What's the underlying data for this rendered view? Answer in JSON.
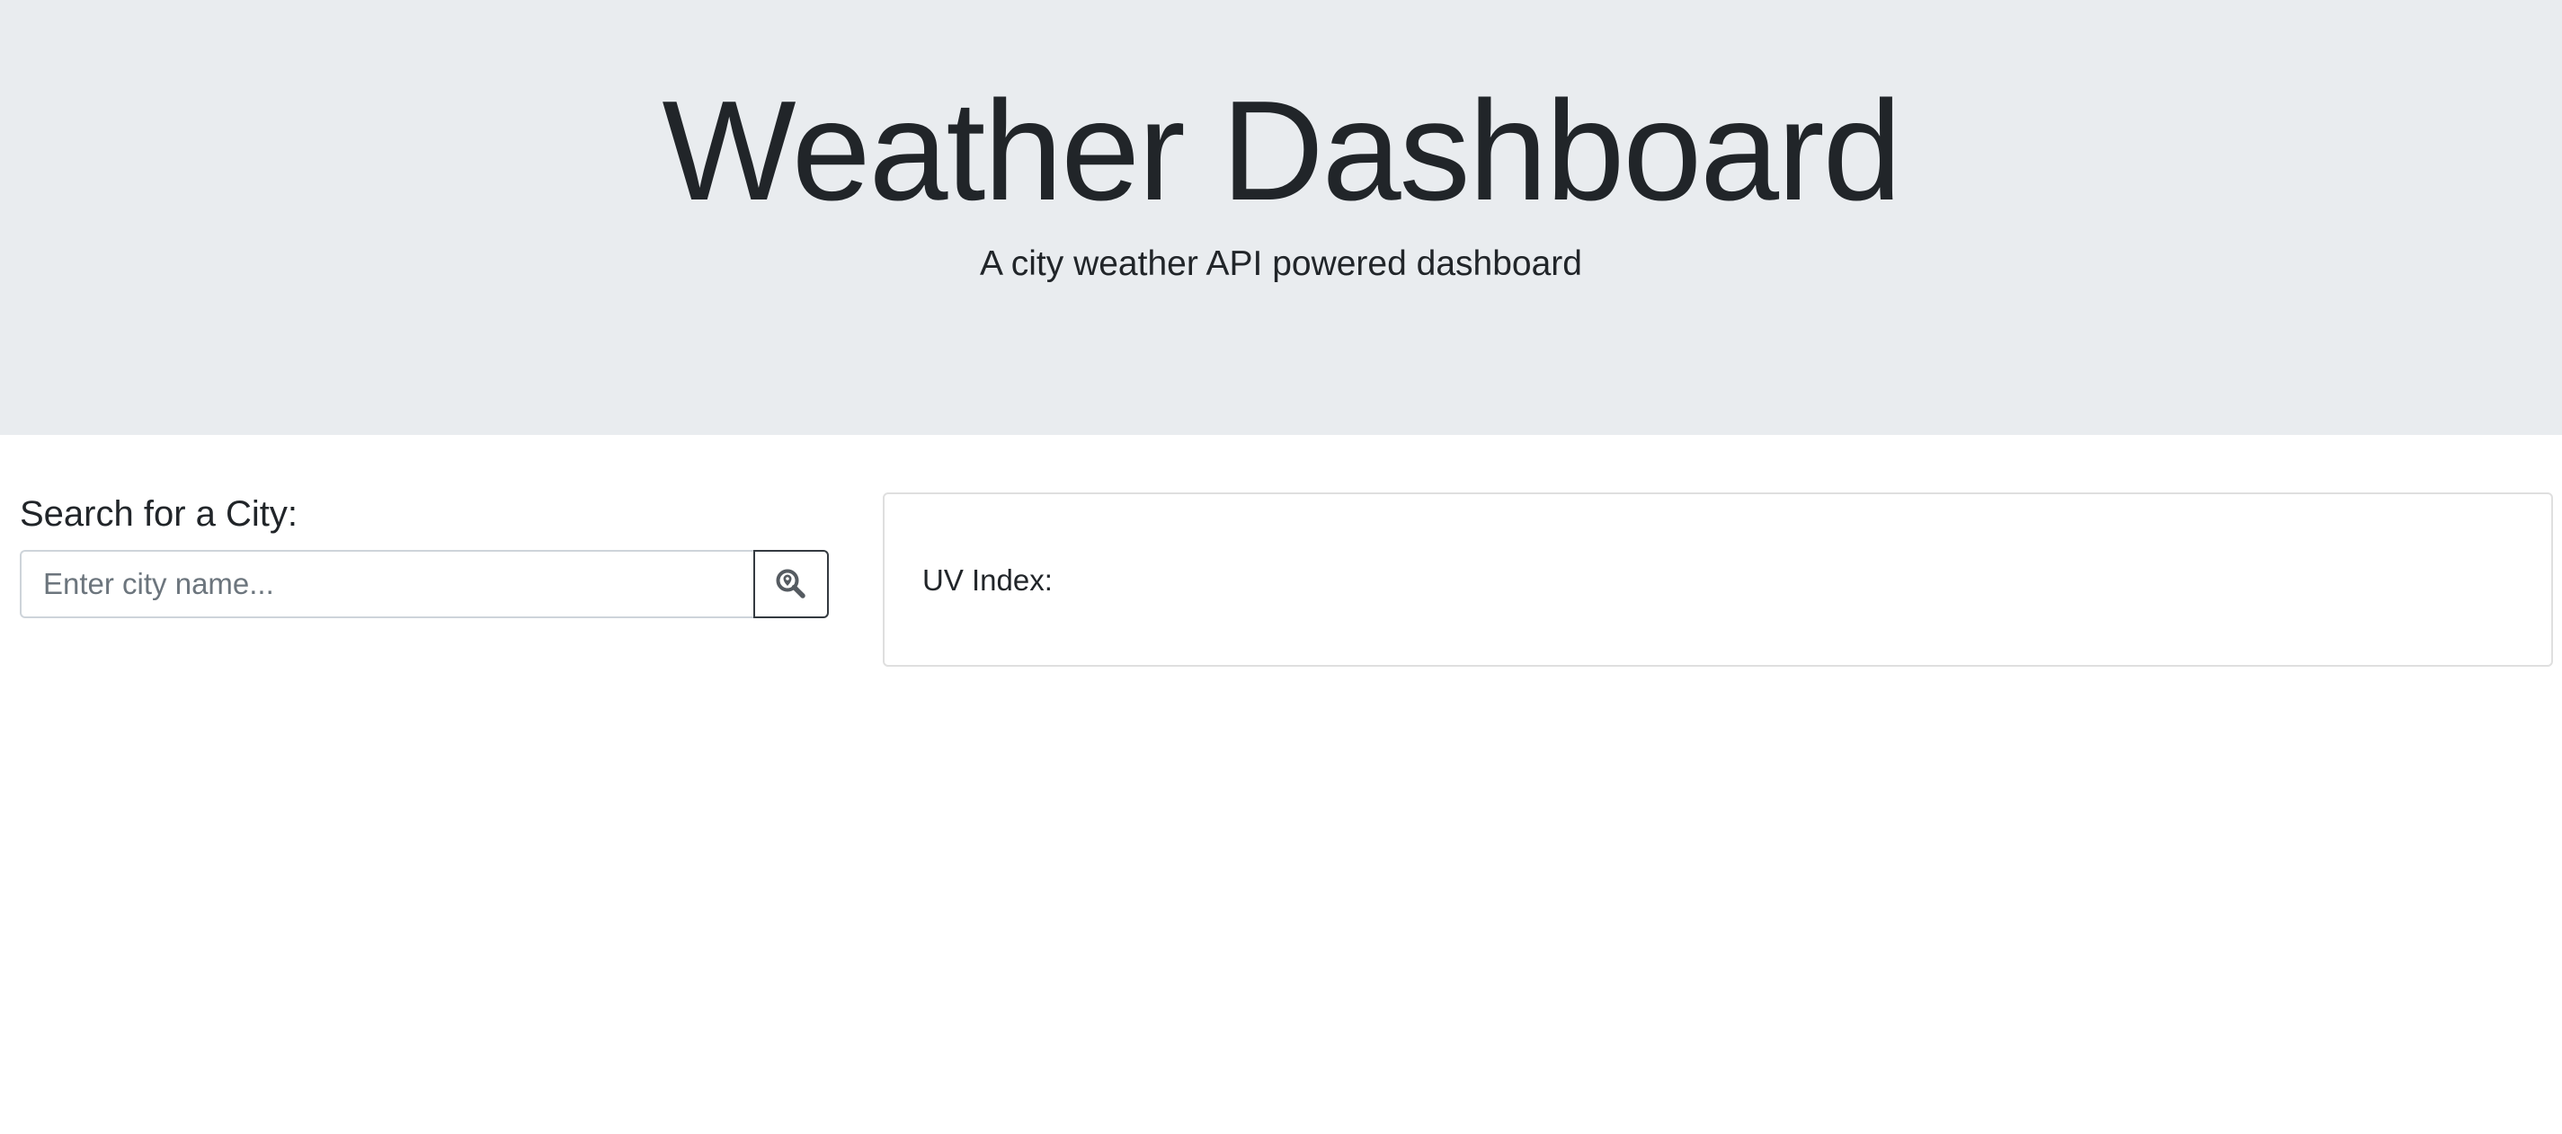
{
  "header": {
    "title": "Weather Dashboard",
    "subtitle": "A city weather API powered dashboard"
  },
  "search": {
    "heading": "Search for a City:",
    "placeholder": "Enter city name...",
    "value": "",
    "button_icon": "search-location-icon"
  },
  "weather_card": {
    "uv_label": "UV Index:"
  },
  "colors": {
    "jumbotron_bg": "#e9ecef",
    "text": "#212529",
    "button_border": "#343a40",
    "icon": "#555b61"
  }
}
